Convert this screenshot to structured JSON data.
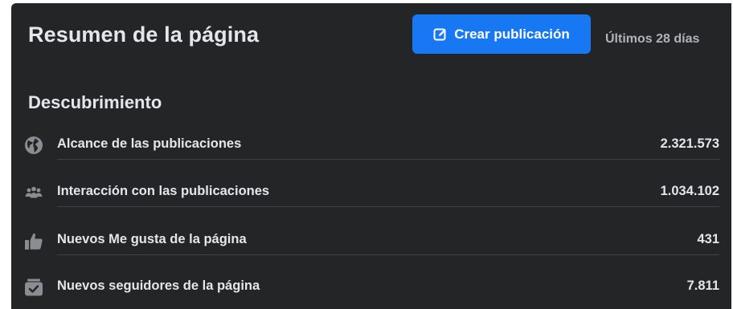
{
  "header": {
    "title": "Resumen de la página",
    "create_button_label": "Crear publicación",
    "date_range": "Últimos 28 días"
  },
  "section": {
    "title": "Descubrimiento",
    "rows": [
      {
        "icon": "globe-icon",
        "label": "Alcance de las publicaciones",
        "value": "2.321.573"
      },
      {
        "icon": "people-icon",
        "label": "Interacción con las publicaciones",
        "value": "1.034.102"
      },
      {
        "icon": "thumbs-up-icon",
        "label": "Nuevos Me gusta de la página",
        "value": "431"
      },
      {
        "icon": "follow-check-icon",
        "label": "Nuevos seguidores de la página",
        "value": "7.811"
      }
    ]
  },
  "colors": {
    "panel_bg": "#242526",
    "accent": "#1877f2",
    "text_primary": "#e4e6eb",
    "text_secondary": "#b0b3b8",
    "icon_gray": "#8a8d91"
  }
}
